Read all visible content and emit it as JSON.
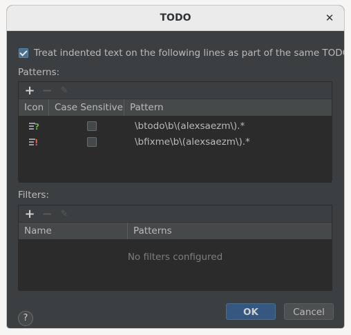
{
  "dialog": {
    "title": "TODO",
    "close_glyph": "✕"
  },
  "treat_indented": {
    "label": "Treat indented text on the following lines as part of the same TODO",
    "checked": true
  },
  "patterns": {
    "label": "Patterns:",
    "toolbar": {
      "add": "+",
      "remove": "−",
      "edit": "✎"
    },
    "columns": [
      "Icon",
      "Case Sensitive",
      "Pattern"
    ],
    "rows": [
      {
        "icon": "todo-question-icon",
        "case_sensitive": false,
        "pattern": "\\btodo\\b\\(alexsaezm\\).*"
      },
      {
        "icon": "todo-exclamation-icon",
        "case_sensitive": false,
        "pattern": "\\bfixme\\b\\(alexsaezm\\).*"
      }
    ]
  },
  "filters": {
    "label": "Filters:",
    "toolbar": {
      "add": "+",
      "remove": "−",
      "edit": "✎"
    },
    "columns": [
      "Name",
      "Patterns"
    ],
    "empty_text": "No filters configured"
  },
  "footer": {
    "help": "?",
    "ok": "OK",
    "cancel": "Cancel"
  },
  "colors": {
    "dialog_bg": "#3c3f41",
    "table_bg": "#2b2b2b",
    "accent": "#365880",
    "icon_question": "#6ab04c",
    "icon_exclamation": "#e55b4d"
  }
}
